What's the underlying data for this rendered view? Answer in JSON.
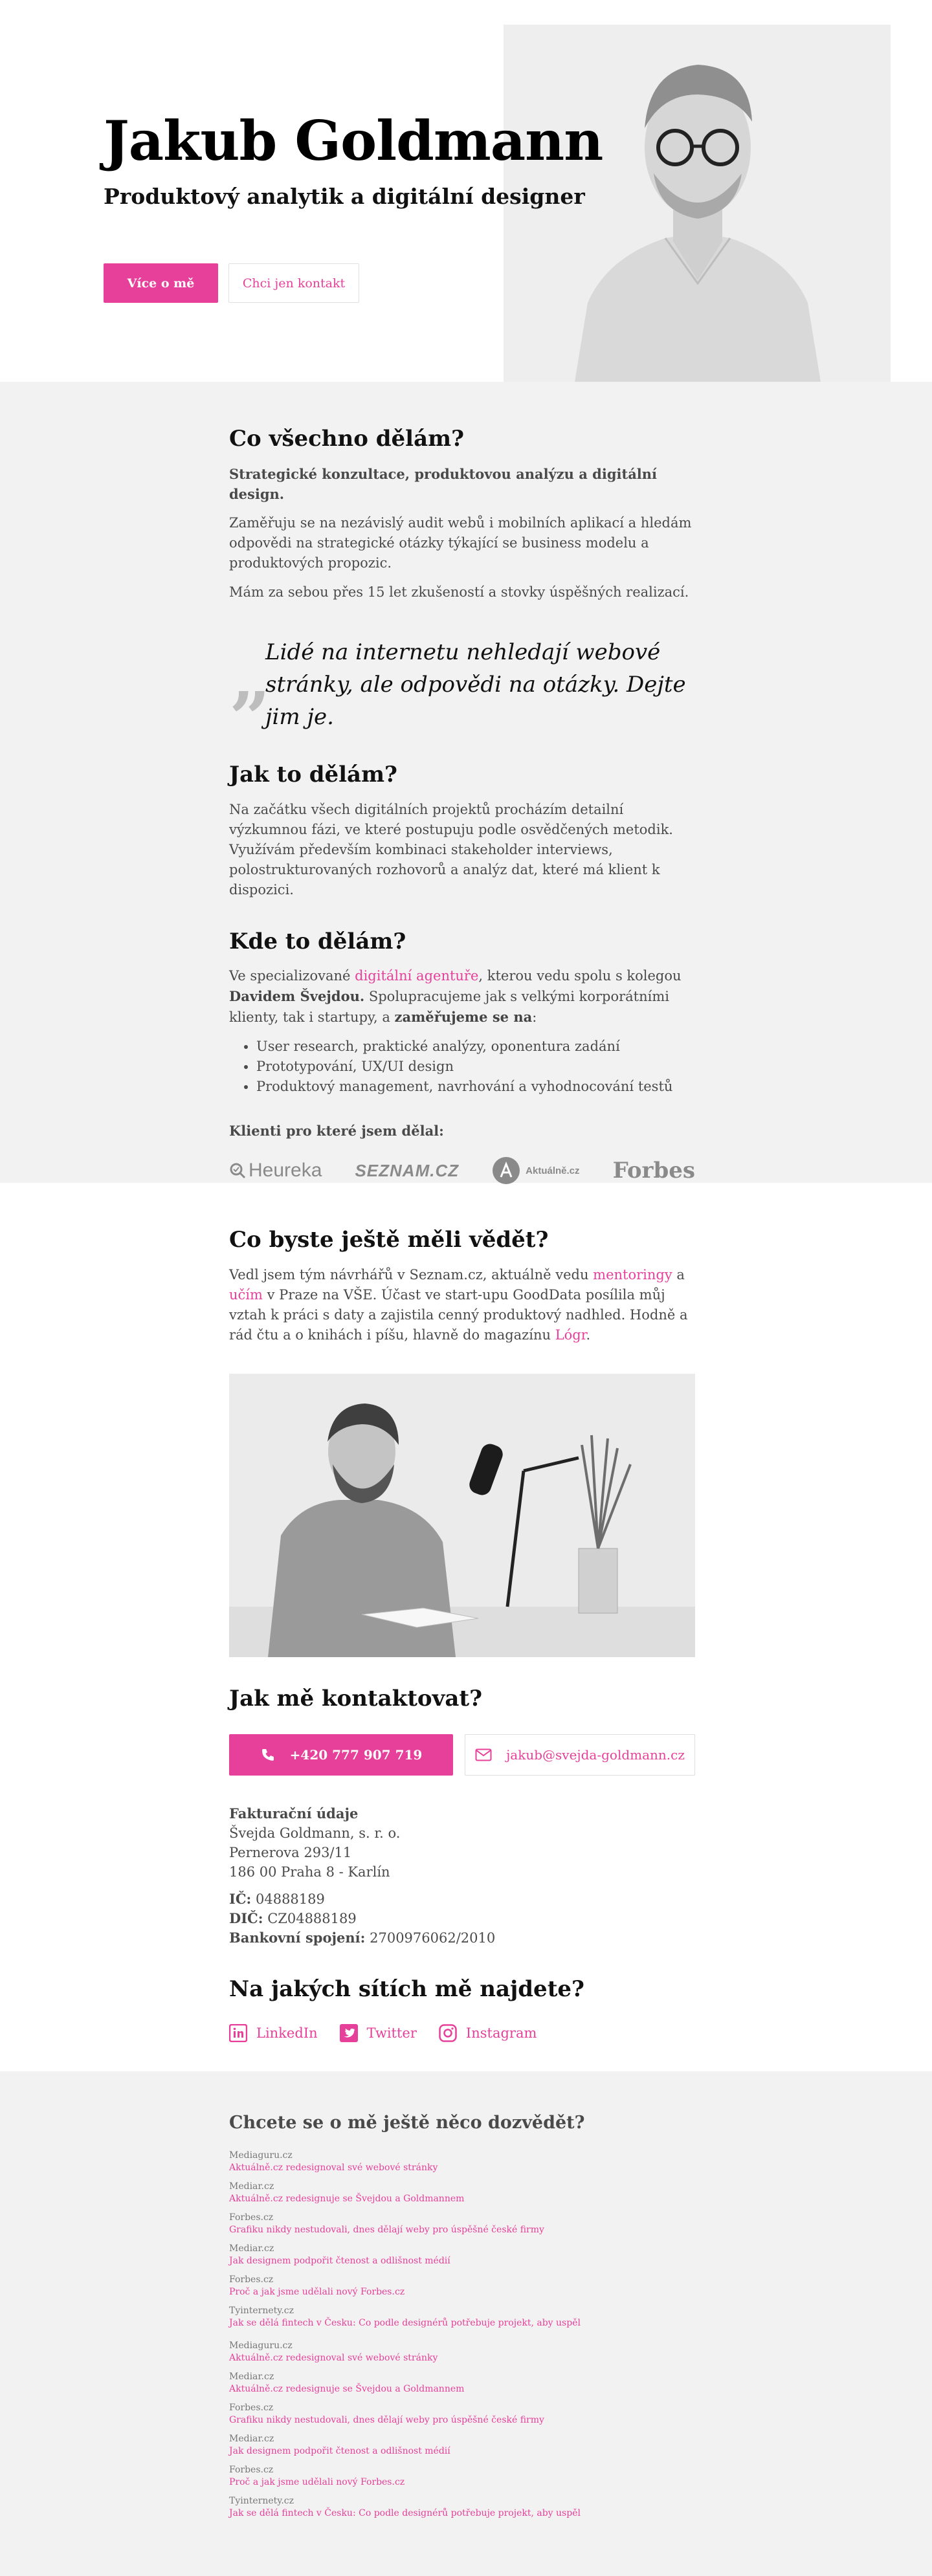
{
  "hero": {
    "name": "Jakub Goldmann",
    "subtitle": "Produktový analytik a digitální designer",
    "primary_button": "Více o mě",
    "secondary_button": "Chci jen kontakt"
  },
  "about": {
    "heading": "Co všechno dělám?",
    "lead": "Strategické konzultace, produktovou analýzu a digitální design.",
    "p1": "Zaměřuju se na nezávislý audit webů i mobilních aplikací a hledám odpovědi na strategické otázky týkající se business modelu a produktových propozic.",
    "p2": "Mám za sebou přes 15 let zkušeností a stovky úspěšných realizací.",
    "quote": "Lidé na internetu nehledají webové stránky, ale odpovědi na otázky. Dejte jim je.",
    "quote_mark": "”",
    "how_heading": "Jak to dělám?",
    "how_text": "Na začátku všech digitálních projektů procházím detailní výzkumnou fázi, ve které postupuju podle osvědčených metodik. Využívám především kombinaci stakeholder interviews, polostrukturovaných rozhovorů a analýz dat, které má klient k dispozici.",
    "where_heading": "Kde to dělám?",
    "where_pre": "Ve specializované ",
    "where_link": "digitální agentuře",
    "where_mid": ", kterou vedu spolu s kolegou ",
    "where_bold": "Davidem Švejdou.",
    "where_post": " Spolupracujeme jak s velkými korporátními klienty, tak i startupy, a ",
    "where_bold2": "zaměřujeme se na",
    "where_colon": ":",
    "services": [
      "User research, praktické analýzy, oponentura zadání",
      "Prototypování, UX/UI design",
      "Produktový management, navrhování a vyhodnocování testů"
    ],
    "clients_title": "Klienti pro které jsem dělal:",
    "clients": [
      "Heureka",
      "SEZNAM.CZ",
      "Aktuálně.cz",
      "Forbes"
    ]
  },
  "more": {
    "heading": "Co byste ještě měli vědět?",
    "t1": "Vedl jsem tým návrhářů v Seznam.cz, aktuálně vedu ",
    "l1": "mentoringy",
    "t2": " a ",
    "l2": "učím",
    "t3": " v Praze na VŠE. Účast ve start-upu GoodData posílila můj vztah k práci s daty a zajistila cenný produktový nadhled. Hodně a rád čtu a o knihách i píšu, hlavně do magazínu ",
    "l3": "Lógr",
    "t4": "."
  },
  "contact": {
    "heading": "Jak mě kontaktovat?",
    "phone": "+420 777 907 719",
    "email": "jakub@svejda-goldmann.cz",
    "billing_title": "Fakturační údaje",
    "company": "Švejda Goldmann, s. r. o.",
    "street": "Pernerova 293/11",
    "city": "186 00 Praha 8 - Karlín",
    "ico_label": "IČ:",
    "ico": "04888189",
    "dic_label": "DIČ:",
    "dic": "CZ04888189",
    "bank_label": "Bankovní spojení:",
    "bank": "2700976062/2010"
  },
  "social": {
    "heading": "Na jakých sítích mě najdete?",
    "items": [
      "LinkedIn",
      "Twitter",
      "Instagram"
    ]
  },
  "articles": {
    "heading": "Chcete se o mě ještě něco dozvědět?",
    "items": [
      {
        "source": "Mediaguru.cz",
        "title": "Aktuálně.cz redesignoval své webové stránky"
      },
      {
        "source": "Mediar.cz",
        "title": "Aktuálně.cz redesignuje se Švejdou a Goldmannem"
      },
      {
        "source": "Forbes.cz",
        "title": "Grafiku nikdy nestudovali, dnes dělají weby pro úspěšné české firmy"
      },
      {
        "source": "Mediar.cz",
        "title": "Jak designem podpořit čtenost a odlišnost médií"
      },
      {
        "source": "Forbes.cz",
        "title": "Proč a jak jsme udělali nový Forbes.cz"
      },
      {
        "source": "Tyinternety.cz",
        "title": "Jak se dělá fintech v Česku: Co podle designérů potřebuje projekt, aby uspěl"
      },
      {
        "source": "Mediaguru.cz",
        "title": "Aktuálně.cz redesignoval své webové stránky"
      },
      {
        "source": "Mediar.cz",
        "title": "Aktuálně.cz redesignuje se Švejdou a Goldmannem"
      },
      {
        "source": "Forbes.cz",
        "title": "Grafiku nikdy nestudovali, dnes dělají weby pro úspěšné české firmy"
      },
      {
        "source": "Mediar.cz",
        "title": "Jak designem podpořit čtenost a odlišnost médií"
      },
      {
        "source": "Forbes.cz",
        "title": "Proč a jak jsme udělali nový Forbes.cz"
      },
      {
        "source": "Tyinternety.cz",
        "title": "Jak se dělá fintech v Česku: Co podle designérů potřebuje projekt, aby uspěl"
      }
    ]
  },
  "colors": {
    "accent": "#e6409a",
    "section_gray": "#f2f2f2",
    "text": "#4a4a4a"
  }
}
